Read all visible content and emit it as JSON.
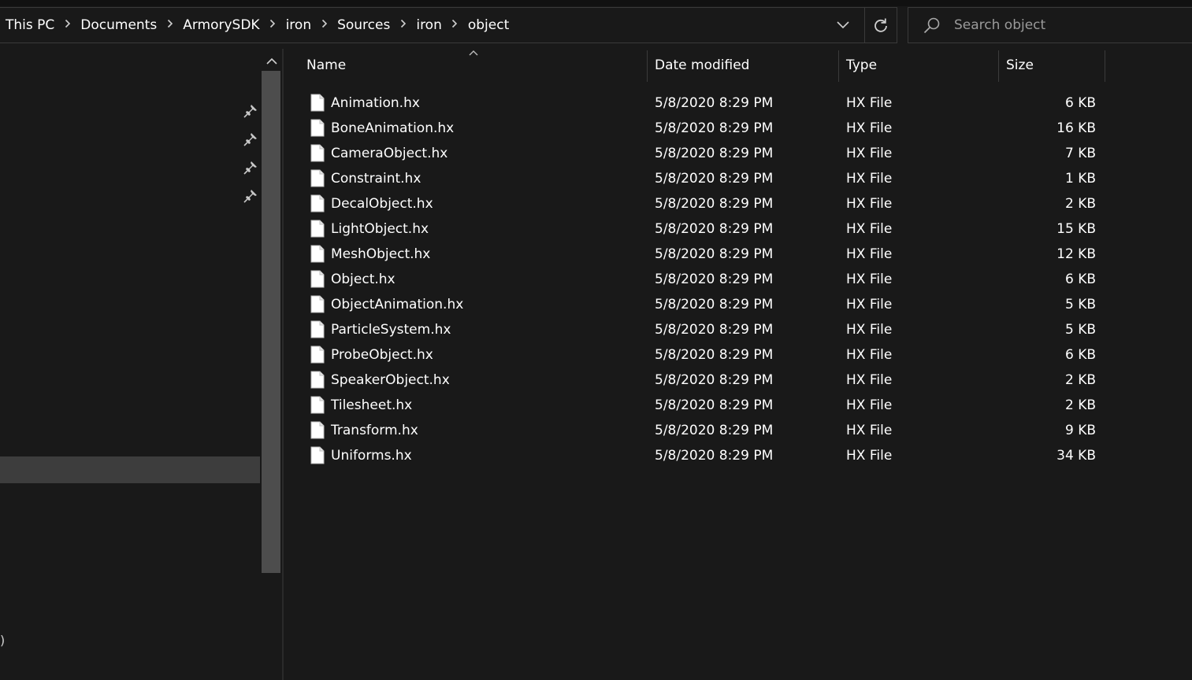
{
  "breadcrumb": [
    "This PC",
    "Documents",
    "ArmorySDK",
    "iron",
    "Sources",
    "iron",
    "object"
  ],
  "search": {
    "placeholder": "Search object"
  },
  "columns": {
    "name": "Name",
    "date": "Date modified",
    "type": "Type",
    "size": "Size"
  },
  "files": [
    {
      "name": "Animation.hx",
      "date": "5/8/2020 8:29 PM",
      "type": "HX File",
      "size": "6 KB"
    },
    {
      "name": "BoneAnimation.hx",
      "date": "5/8/2020 8:29 PM",
      "type": "HX File",
      "size": "16 KB"
    },
    {
      "name": "CameraObject.hx",
      "date": "5/8/2020 8:29 PM",
      "type": "HX File",
      "size": "7 KB"
    },
    {
      "name": "Constraint.hx",
      "date": "5/8/2020 8:29 PM",
      "type": "HX File",
      "size": "1 KB"
    },
    {
      "name": "DecalObject.hx",
      "date": "5/8/2020 8:29 PM",
      "type": "HX File",
      "size": "2 KB"
    },
    {
      "name": "LightObject.hx",
      "date": "5/8/2020 8:29 PM",
      "type": "HX File",
      "size": "15 KB"
    },
    {
      "name": "MeshObject.hx",
      "date": "5/8/2020 8:29 PM",
      "type": "HX File",
      "size": "12 KB"
    },
    {
      "name": "Object.hx",
      "date": "5/8/2020 8:29 PM",
      "type": "HX File",
      "size": "6 KB"
    },
    {
      "name": "ObjectAnimation.hx",
      "date": "5/8/2020 8:29 PM",
      "type": "HX File",
      "size": "5 KB"
    },
    {
      "name": "ParticleSystem.hx",
      "date": "5/8/2020 8:29 PM",
      "type": "HX File",
      "size": "5 KB"
    },
    {
      "name": "ProbeObject.hx",
      "date": "5/8/2020 8:29 PM",
      "type": "HX File",
      "size": "6 KB"
    },
    {
      "name": "SpeakerObject.hx",
      "date": "5/8/2020 8:29 PM",
      "type": "HX File",
      "size": "2 KB"
    },
    {
      "name": "Tilesheet.hx",
      "date": "5/8/2020 8:29 PM",
      "type": "HX File",
      "size": "2 KB"
    },
    {
      "name": "Transform.hx",
      "date": "5/8/2020 8:29 PM",
      "type": "HX File",
      "size": "9 KB"
    },
    {
      "name": "Uniforms.hx",
      "date": "5/8/2020 8:29 PM",
      "type": "HX File",
      "size": "34 KB"
    }
  ],
  "nav": {
    "partial_text": ")"
  },
  "icons": {
    "breadcrumb_separator": "chevron-right-icon",
    "address_dropdown": "chevron-down-icon",
    "refresh": "refresh-icon",
    "search": "search-icon",
    "pin": "pin-icon",
    "file": "file-icon"
  },
  "colors": {
    "background": "#191919",
    "border": "#3a3a3a",
    "selection": "#3d3d3d",
    "scroll_thumb": "#4d4d4d",
    "text": "#ffffff",
    "placeholder": "#9a9a9a"
  }
}
